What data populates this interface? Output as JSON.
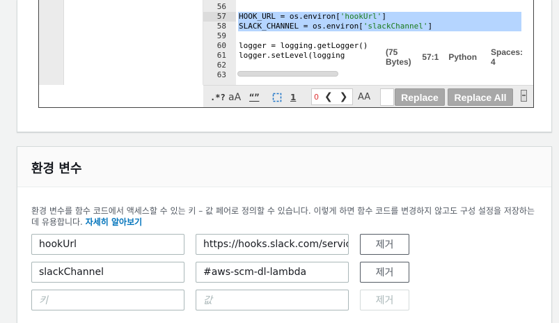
{
  "editor": {
    "lines": [
      {
        "num": "56",
        "text": ""
      },
      {
        "num": "57",
        "segments": [
          [
            "HOOK_URL = os.environ[",
            ""
          ],
          [
            "'hookUrl'",
            "str"
          ],
          [
            "]",
            ""
          ]
        ]
      },
      {
        "num": "58",
        "segments": [
          [
            "SLACK_CHANNEL = os.environ[",
            ""
          ],
          [
            "'slackChannel'",
            "str"
          ],
          [
            "]",
            ""
          ]
        ]
      },
      {
        "num": "59",
        "text": ""
      },
      {
        "num": "60",
        "text": "logger = logging.getLogger()"
      },
      {
        "num": "61",
        "text": "logger.setLevel(logging"
      },
      {
        "num": "62",
        "text": ""
      },
      {
        "num": "63",
        "text": ""
      }
    ],
    "status": {
      "size": "(75 Bytes)",
      "position": "57:1",
      "language": "Python",
      "spaces": "Spaces: 4"
    }
  },
  "search_bar": {
    "regex_label": ".*?",
    "case_label": "aA",
    "word_label": "“”",
    "match_count": "0",
    "preserve_case_label": "AA",
    "replace_label": "Replace",
    "replace_all_label": "Replace All"
  },
  "env": {
    "title": "환경 변수",
    "description": "환경 변수를 함수 코드에서 액세스할 수 있는 키 – 값 페어로 정의할 수 있습니다. 이렇게 하면 함수 코드를 변경하지 않고도 구성 설정을 저장하는 데 유용합니다.",
    "learn_more": "자세히 알아보기",
    "rows": [
      {
        "key": "hookUrl",
        "value": "https://hooks.slack.com/services"
      },
      {
        "key": "slackChannel",
        "value": "#aws-scm-dl-lambda"
      }
    ],
    "key_placeholder": "키",
    "value_placeholder": "값",
    "remove_label": "제거"
  }
}
